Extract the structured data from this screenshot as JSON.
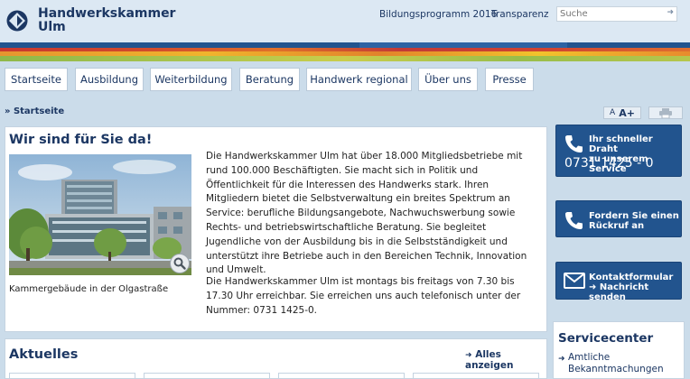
{
  "header": {
    "logo_line1": "Handwerkskammer",
    "logo_line2": "Ulm",
    "links": [
      "Bildungsprogramm 2016",
      "Transparenz"
    ],
    "search": {
      "placeholder": "Suche"
    }
  },
  "nav": {
    "items": [
      "Startseite",
      "Ausbildung",
      "Weiterbildung",
      "Beratung",
      "Handwerk regional",
      "Über uns",
      "Presse"
    ]
  },
  "breadcrumb": "» Startseite",
  "font_tools": {
    "small": "A",
    "large": "A+"
  },
  "main": {
    "title": "Wir sind für Sie da!",
    "caption": "Kammergebäude in der Olgastraße",
    "paragraph1": "Die Handwerkskammer Ulm hat über 18.000 Mitgliedsbetriebe mit rund 100.000 Beschäftigten. Sie macht sich in Politik und Öffentlichkeit für die Interessen des Handwerks stark. Ihren Mitgliedern bietet die Selbstverwaltung ein breites Spektrum an Service: berufliche Bildungsangebote, Nachwuchswerbung sowie Rechts- und betriebswirtschaftliche Beratung. Sie begleitet Jugendliche von der Ausbildung bis in die Selbstständigkeit und unterstützt ihre Betriebe auch in den Bereichen Technik, Innovation und Umwelt.",
    "paragraph2": "Die Handwerkskammer Ulm ist montags bis freitags von 7.30 bis 17.30 Uhr erreichbar. Sie erreichen uns auch telefonisch unter der Nummer: 0731 1425-0."
  },
  "sidebar": {
    "hotline": {
      "line1": "Ihr schneller Draht",
      "line2": "zu unserem Service",
      "phone": "0731 1425 - 0"
    },
    "callback": {
      "line1": "Fordern Sie einen",
      "line2": "Rückruf an"
    },
    "contact": {
      "line1": "Kontaktformular",
      "line2": "➜ Nachricht senden"
    },
    "service_title": "Servicecenter",
    "service_link_line1": "Amtliche",
    "service_link_line2": "Bekanntmachungen"
  },
  "news": {
    "title": "Aktuelles",
    "all_label": "Alles anzeigen"
  },
  "colors": {
    "brand": "#1c3763",
    "accent": "#22548e",
    "background": "#cbdcea"
  }
}
